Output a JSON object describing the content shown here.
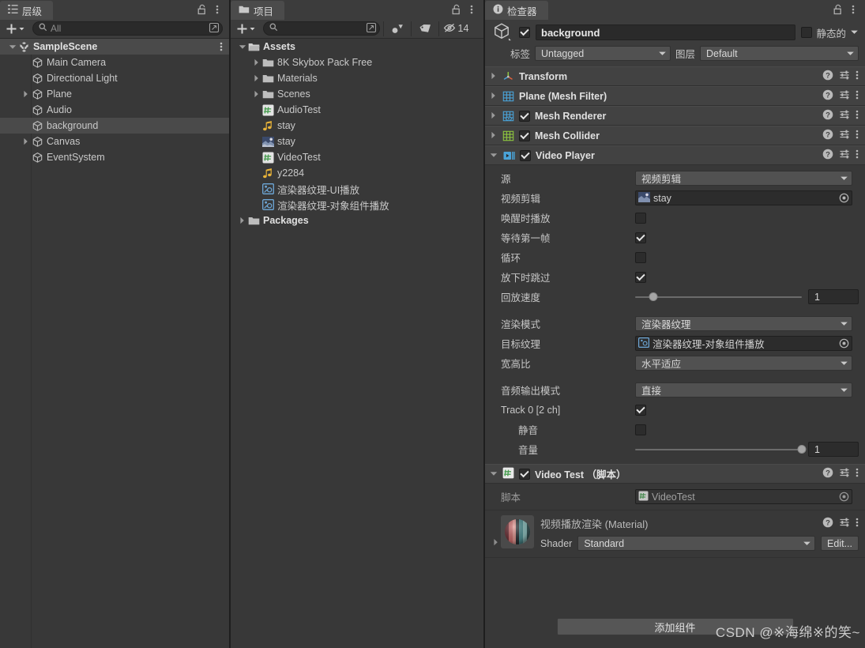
{
  "hierarchy": {
    "tab_label": "层级",
    "tab_icon": "hierarchy-icon",
    "lock_icon": "lock-icon",
    "menu_icon": "kebab-menu-icon",
    "add_label": "+",
    "search_placeholder": "All",
    "search_value": "",
    "items": [
      {
        "label": "SampleScene",
        "icon": "unity-scene-icon",
        "depth": 0,
        "arrow": "down",
        "selected": false,
        "scene": true
      },
      {
        "label": "Main Camera",
        "icon": "gameobject-icon",
        "depth": 1,
        "arrow": "none",
        "selected": false,
        "scene": false
      },
      {
        "label": "Directional Light",
        "icon": "gameobject-icon",
        "depth": 1,
        "arrow": "none",
        "selected": false,
        "scene": false
      },
      {
        "label": "Plane",
        "icon": "gameobject-icon",
        "depth": 1,
        "arrow": "right",
        "selected": false,
        "scene": false
      },
      {
        "label": "Audio",
        "icon": "gameobject-icon",
        "depth": 1,
        "arrow": "none",
        "selected": false,
        "scene": false
      },
      {
        "label": "background",
        "icon": "gameobject-icon",
        "depth": 1,
        "arrow": "none",
        "selected": true,
        "scene": false
      },
      {
        "label": "Canvas",
        "icon": "gameobject-icon",
        "depth": 1,
        "arrow": "right",
        "selected": false,
        "scene": false
      },
      {
        "label": "EventSystem",
        "icon": "gameobject-icon",
        "depth": 1,
        "arrow": "none",
        "selected": false,
        "scene": false
      }
    ]
  },
  "project": {
    "tab_label": "项目",
    "tab_icon": "folder-icon",
    "lock_icon": "lock-icon",
    "menu_icon": "kebab-menu-icon",
    "add_label": "+",
    "search_placeholder": "",
    "search_value": "",
    "toolbar_icons": [
      "search-by-type-icon",
      "search-by-label-icon",
      "hidden-packages-icon"
    ],
    "hidden_count": "14",
    "items": [
      {
        "label": "Assets",
        "icon": "folder-open-icon",
        "depth": 0,
        "arrow": "down",
        "bold": true
      },
      {
        "label": "8K Skybox Pack Free",
        "icon": "folder-icon",
        "depth": 1,
        "arrow": "right",
        "bold": false
      },
      {
        "label": "Materials",
        "icon": "folder-icon",
        "depth": 1,
        "arrow": "right",
        "bold": false
      },
      {
        "label": "Scenes",
        "icon": "folder-icon",
        "depth": 1,
        "arrow": "right",
        "bold": false
      },
      {
        "label": "AudioTest",
        "icon": "csharp-script-icon",
        "depth": 1,
        "arrow": "none",
        "bold": false
      },
      {
        "label": "stay",
        "icon": "audio-clip-icon",
        "depth": 1,
        "arrow": "none",
        "bold": false
      },
      {
        "label": "stay",
        "icon": "video-clip-icon",
        "depth": 1,
        "arrow": "none",
        "bold": false
      },
      {
        "label": "VideoTest",
        "icon": "csharp-script-icon",
        "depth": 1,
        "arrow": "none",
        "bold": false
      },
      {
        "label": "y2284",
        "icon": "audio-clip-icon",
        "depth": 1,
        "arrow": "none",
        "bold": false
      },
      {
        "label": "渲染器纹理-UI播放",
        "icon": "render-texture-icon",
        "depth": 1,
        "arrow": "none",
        "bold": false
      },
      {
        "label": "渲染器纹理-对象组件播放",
        "icon": "render-texture-icon",
        "depth": 1,
        "arrow": "none",
        "bold": false
      },
      {
        "label": "Packages",
        "icon": "folder-icon",
        "depth": 0,
        "arrow": "right",
        "bold": true
      }
    ]
  },
  "inspector": {
    "tab_label": "检查器",
    "tab_icon": "info-icon",
    "lock_icon": "lock-icon",
    "menu_icon": "kebab-menu-icon",
    "object_icon": "gameobject-icon",
    "enabled": true,
    "name": "background",
    "static_label": "静态的",
    "static_checked": false,
    "tag_label": "标签",
    "tag_value": "Untagged",
    "layer_label": "图层",
    "layer_value": "Default",
    "components": [
      {
        "title": "Transform",
        "icon": "transform-icon",
        "expanded": false,
        "has_checkbox": false,
        "checked": false
      },
      {
        "title": "Plane (Mesh Filter)",
        "icon": "mesh-filter-icon",
        "expanded": false,
        "has_checkbox": false,
        "checked": false
      },
      {
        "title": "Mesh Renderer",
        "icon": "mesh-renderer-icon",
        "expanded": false,
        "has_checkbox": true,
        "checked": true
      },
      {
        "title": "Mesh Collider",
        "icon": "mesh-collider-icon",
        "expanded": false,
        "has_checkbox": true,
        "checked": true
      },
      {
        "title": "Video Player",
        "icon": "video-player-icon",
        "expanded": true,
        "has_checkbox": true,
        "checked": true
      }
    ],
    "video_player": {
      "source_label": "源",
      "source_value": "视频剪辑",
      "clip_label": "视频剪辑",
      "clip_value": "stay",
      "clip_icon": "video-clip-icon",
      "play_on_awake_label": "唤醒时播放",
      "play_on_awake": false,
      "wait_first_frame_label": "等待第一帧",
      "wait_first_frame": true,
      "loop_label": "循环",
      "loop": false,
      "skip_on_drop_label": "放下时跳过",
      "skip_on_drop": true,
      "playback_speed_label": "回放速度",
      "playback_speed_value": "1",
      "playback_speed_pct": 11,
      "render_mode_label": "渲染模式",
      "render_mode_value": "渲染器纹理",
      "target_texture_label": "目标纹理",
      "target_texture_value": "渲染器纹理-对象组件播放",
      "target_texture_icon": "render-texture-icon",
      "aspect_ratio_label": "宽高比",
      "aspect_ratio_value": "水平适应",
      "audio_output_label": "音频输出模式",
      "audio_output_value": "直接",
      "track_label": "Track 0 [2 ch]",
      "track_enabled": true,
      "mute_label": "静音",
      "mute": false,
      "volume_label": "音量",
      "volume_value": "1",
      "volume_pct": 100
    },
    "script_component": {
      "title": "Video Test （脚本）",
      "icon": "csharp-script-icon",
      "checked": true,
      "expanded": true,
      "script_label": "脚本",
      "script_value": "VideoTest",
      "script_icon": "csharp-script-icon"
    },
    "material": {
      "title": "视频播放渲染 (Material)",
      "preview_icon": "material-sphere-icon",
      "shader_label": "Shader",
      "shader_value": "Standard",
      "edit_label": "Edit..."
    },
    "add_component_label": "添加组件"
  },
  "watermark": {
    "text": "CSDN @※海绵※的笑~"
  },
  "colors": {
    "panel_bg": "#383838",
    "header_bg": "#3c3c3c",
    "tab_active": "#4b4b4b",
    "component_header": "#424242",
    "selection": "#4a4a4a",
    "field_bg": "#2c2c2c",
    "dropdown_bg": "#515151",
    "text": "#c9c9c9"
  }
}
